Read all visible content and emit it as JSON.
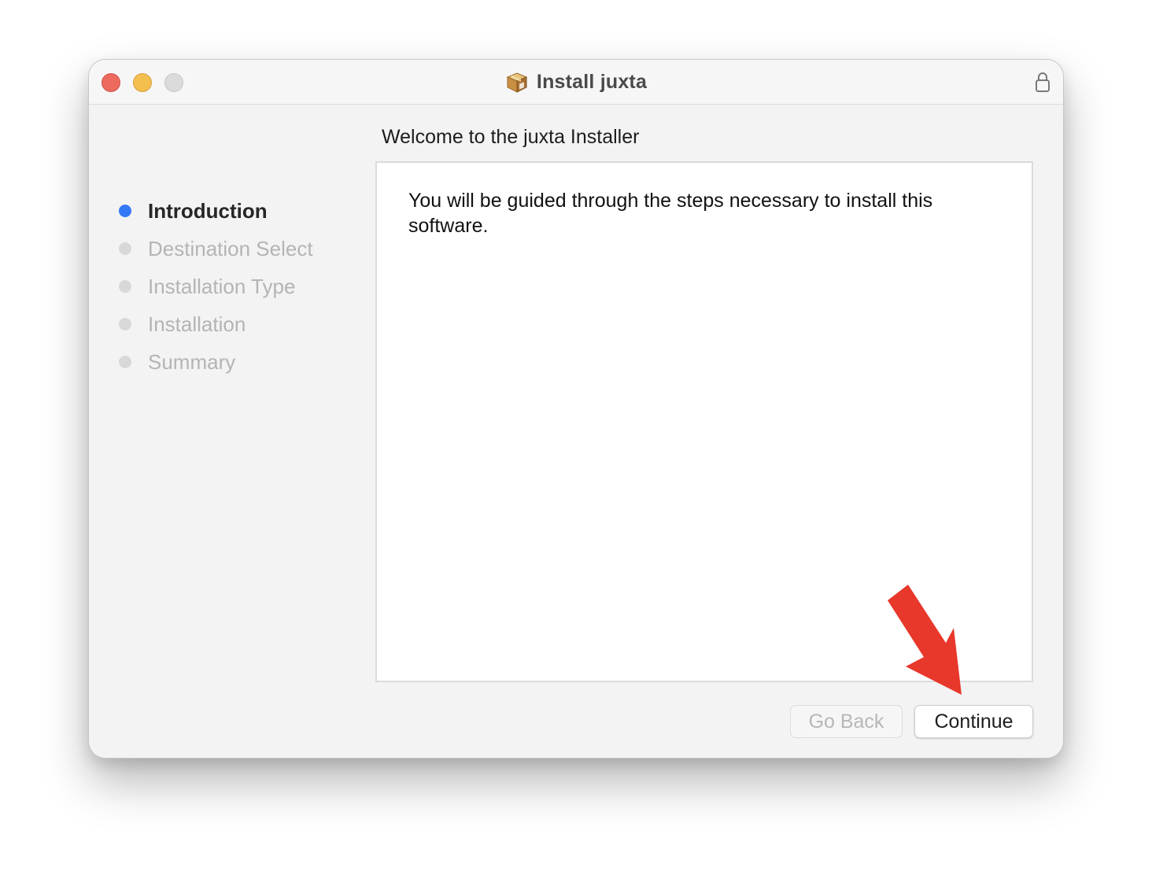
{
  "window": {
    "title": "Install juxta",
    "title_icon": "package-icon",
    "lock_icon": "lock-icon"
  },
  "heading": "Welcome to the juxta Installer",
  "sidebar": {
    "steps": [
      {
        "label": "Introduction",
        "active": true
      },
      {
        "label": "Destination Select",
        "active": false
      },
      {
        "label": "Installation Type",
        "active": false
      },
      {
        "label": "Installation",
        "active": false
      },
      {
        "label": "Summary",
        "active": false
      }
    ]
  },
  "content": {
    "body": "You will be guided through the steps necessary to install this software."
  },
  "buttons": {
    "go_back": "Go Back",
    "continue": "Continue"
  },
  "colors": {
    "accent": "#3478f6",
    "annotation_arrow": "#e8372b",
    "close": "#ec6a5e",
    "minimize": "#f4bf4f",
    "zoom": "#dcdbdc"
  }
}
